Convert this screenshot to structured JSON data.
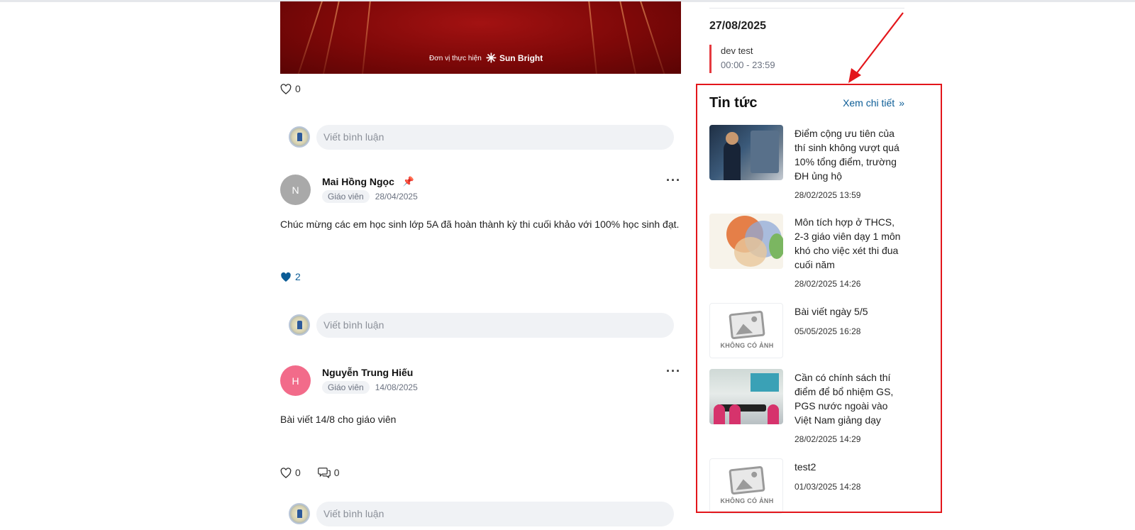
{
  "banner": {
    "credit_label": "Đơn vị thực hiện",
    "brand": "Sun Bright"
  },
  "comment_placeholder": "Viết bình luận",
  "post0": {
    "likes": "0"
  },
  "posts": [
    {
      "avatar_letter": "N",
      "avatar_color": "#a9a9a9",
      "author": "Mai Hồng Ngọc",
      "pinned": true,
      "role": "Giáo viên",
      "date": "28/04/2025",
      "body": "Chúc mừng các em học sinh lớp 5A đã hoàn thành kỳ thi cuối khảo với 100% học sinh đạt.",
      "likes": "2",
      "liked": true
    },
    {
      "avatar_letter": "H",
      "avatar_color": "#f26b8a",
      "author": "Nguyễn Trung Hiếu",
      "pinned": false,
      "role": "Giáo viên",
      "date": "14/08/2025",
      "body": "Bài viết 14/8 cho giáo viên",
      "likes": "0",
      "comments": "0",
      "liked": false
    }
  ],
  "sidebar": {
    "event_date": "27/08/2025",
    "event": {
      "title": "dev test",
      "time": "00:00 - 23:59",
      "accent": "#e5393f"
    }
  },
  "news": {
    "title": "Tin tức",
    "more_label": "Xem chi tiết",
    "no_image_label": "KHÔNG CÓ ẢNH",
    "items": [
      {
        "title": "Điểm cộng ưu tiên của thí sinh không vượt quá 10% tổng điểm, trường ĐH ủng hộ",
        "date": "28/02/2025 13:59"
      },
      {
        "title": "Môn tích hợp ở THCS, 2-3 giáo viên dạy 1 môn khó cho việc xét thi đua cuối năm",
        "date": "28/02/2025 14:26"
      },
      {
        "title": "Bài viết ngày 5/5",
        "date": "05/05/2025 16:28"
      },
      {
        "title": "Cần có chính sách thí điểm để bổ nhiệm GS, PGS nước ngoài vào Việt Nam giảng dạy",
        "date": "28/02/2025 14:29"
      },
      {
        "title": "test2",
        "date": "01/03/2025 14:28"
      }
    ]
  },
  "colors": {
    "link": "#0b5c96",
    "annotation_red": "#e3161b",
    "banner_red": "#7d0808"
  }
}
